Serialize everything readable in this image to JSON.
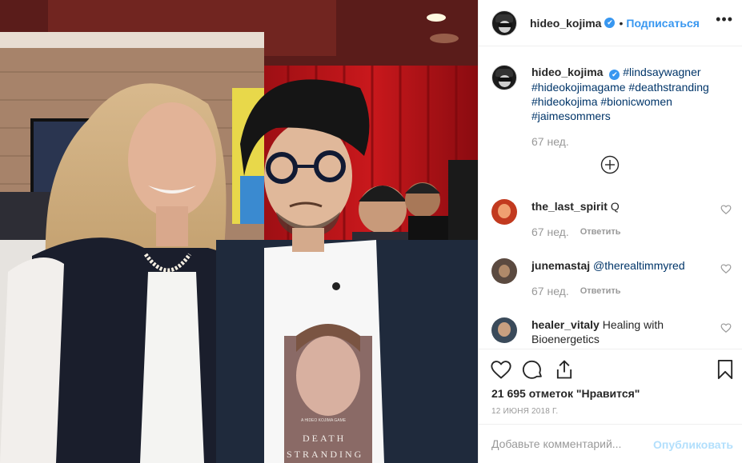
{
  "post": {
    "author": "hideo_kojima",
    "follow_label": "Подписаться",
    "more_label": "•••",
    "dot_label": "•",
    "verified_glyph": "✔",
    "caption_tags": [
      "#lindsaywagner",
      "#hideokojimagame",
      "#deathstranding",
      "#hideokojima",
      "#bionicwomen",
      "#jaimesommers"
    ],
    "caption_age": "67 нед.",
    "likes": "21 695 отметок \"Нравится\"",
    "date": "12 ИЮНЯ 2018 Г.",
    "add_comment_placeholder": "Добавьте комментарий...",
    "publish_label": "Опубликовать",
    "photo_shirt_text": "DEATH STRANDING",
    "photo_shirt_small": "A HIDEO KOJIMA GAME"
  },
  "comments": [
    {
      "user": "the_last_spirit",
      "text": "Q",
      "age": "67 нед.",
      "reply": "Ответить"
    },
    {
      "user": "junemastaj",
      "text": "@therealtimmyred",
      "age": "67 нед.",
      "reply": "Ответить"
    },
    {
      "user": "healer_vitaly",
      "text": "Healing with Bioenergetics",
      "age": "",
      "reply": ""
    }
  ],
  "icons": [
    "heart-icon",
    "comment-icon",
    "share-icon",
    "bookmark-icon",
    "plus-circle-icon",
    "more-icon",
    "verified-icon"
  ],
  "colors": {
    "accent": "#3897f0",
    "muted": "#999999",
    "publish_disabled": "#b2dffc",
    "tag": "#003569"
  }
}
